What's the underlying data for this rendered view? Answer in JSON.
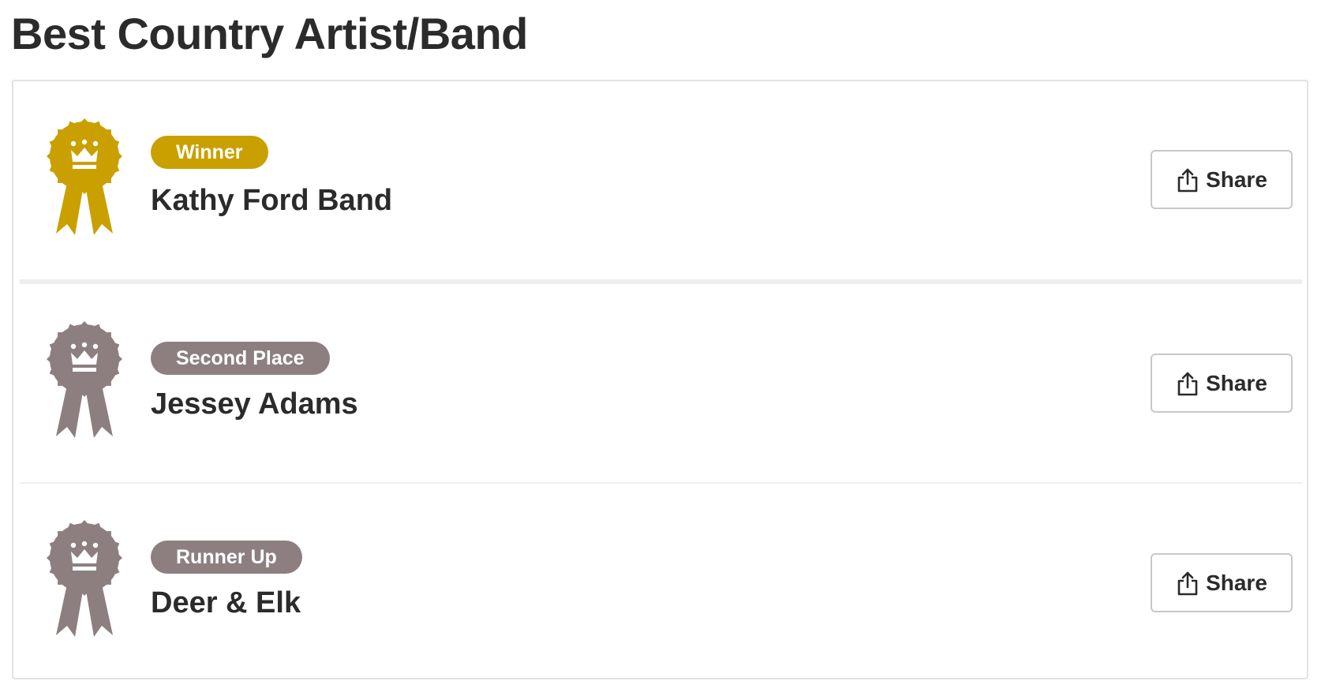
{
  "page": {
    "title": "Best Country Artist/Band"
  },
  "colors": {
    "winner": "#c9a000",
    "other": "#8d7f80"
  },
  "results": [
    {
      "place": "Winner",
      "name": "Kathy Ford Band",
      "share_label": "Share",
      "icon": "award-ribbon-icon",
      "color": "#c9a000"
    },
    {
      "place": "Second Place",
      "name": "Jessey Adams",
      "share_label": "Share",
      "icon": "award-ribbon-icon",
      "color": "#8d7f80"
    },
    {
      "place": "Runner Up",
      "name": "Deer & Elk",
      "share_label": "Share",
      "icon": "award-ribbon-icon",
      "color": "#8d7f80"
    }
  ]
}
